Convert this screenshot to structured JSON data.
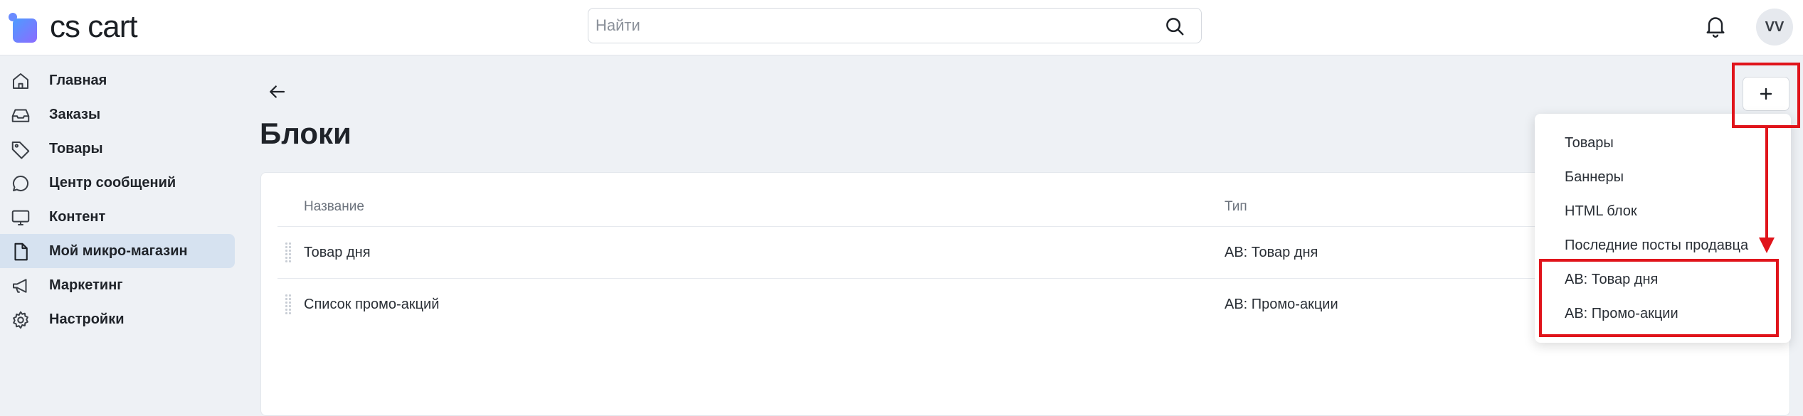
{
  "header": {
    "logo_text": "cs cart",
    "search_placeholder": "Найти",
    "avatar_initials": "VV"
  },
  "sidebar": {
    "items": [
      {
        "label": "Главная",
        "icon": "home-icon"
      },
      {
        "label": "Заказы",
        "icon": "inbox-icon"
      },
      {
        "label": "Товары",
        "icon": "tag-icon"
      },
      {
        "label": "Центр сообщений",
        "icon": "chat-icon"
      },
      {
        "label": "Контент",
        "icon": "monitor-icon"
      },
      {
        "label": "Мой микро-магазин",
        "icon": "file-icon",
        "active": true
      },
      {
        "label": "Маркетинг",
        "icon": "megaphone-icon"
      },
      {
        "label": "Настройки",
        "icon": "gear-icon"
      }
    ]
  },
  "main": {
    "title": "Блоки",
    "table": {
      "columns": [
        "Название",
        "Тип"
      ],
      "rows": [
        {
          "name": "Товар дня",
          "type": "AB: Товар дня"
        },
        {
          "name": "Список промо-акций",
          "type": "AB: Промо-акции"
        }
      ]
    }
  },
  "add_menu": {
    "items": [
      "Товары",
      "Баннеры",
      "HTML блок",
      "Последние посты продавца",
      "AB: Товар дня",
      "AB: Промо-акции"
    ]
  },
  "colors": {
    "annotation": "#e0141b",
    "active_nav": "#d6e2f0",
    "background": "#eef1f5"
  }
}
